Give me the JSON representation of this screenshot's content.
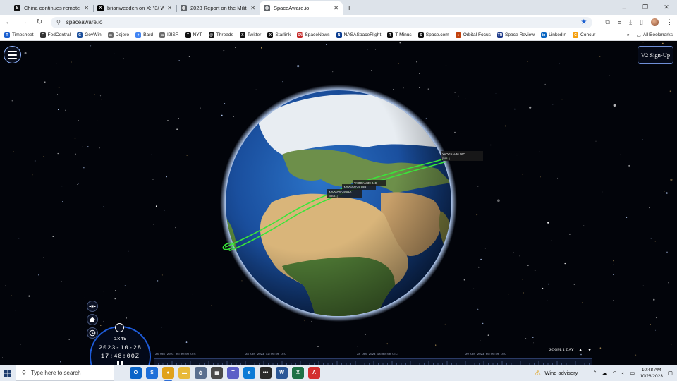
{
  "browser": {
    "tabs": [
      {
        "title": "China continues remote-sensin",
        "favicon": "S",
        "color": "#111111",
        "active": false
      },
      {
        "title": "brianweeden on X: \"3/ While i",
        "favicon": "X",
        "color": "#000000",
        "active": false
      },
      {
        "title": "2023 Report on the Military an",
        "favicon": "globe",
        "color": "#5f6368",
        "active": false
      },
      {
        "title": "SpaceAware.io",
        "favicon": "globe",
        "color": "#5f6368",
        "active": true
      }
    ],
    "new_tab": "+",
    "window_controls": [
      "–",
      "❐",
      "✕"
    ],
    "url": "spaceaware.io"
  },
  "bookmarks": {
    "items": [
      {
        "label": "Timesheet",
        "color": "#1a5fd0",
        "glyph": "T"
      },
      {
        "label": "FedCentral",
        "color": "#333333",
        "glyph": "F"
      },
      {
        "label": "GovWin",
        "color": "#1b4f9c",
        "glyph": "G"
      },
      {
        "label": "Dejero",
        "color": "#6b6b6b",
        "glyph": "▭"
      },
      {
        "label": "Bard",
        "color": "#4285f4",
        "glyph": "✦"
      },
      {
        "label": "I2ISR",
        "color": "#6b6b6b",
        "glyph": "▭"
      },
      {
        "label": "NYT",
        "color": "#111111",
        "glyph": "T"
      },
      {
        "label": "Threads",
        "color": "#111111",
        "glyph": "@"
      },
      {
        "label": "Twitter",
        "color": "#111111",
        "glyph": "X"
      },
      {
        "label": "Starlink",
        "color": "#111111",
        "glyph": "X"
      },
      {
        "label": "SpaceNews",
        "color": "#c62828",
        "glyph": "SN"
      },
      {
        "label": "NASASpaceFlight",
        "color": "#0b3d91",
        "glyph": "N"
      },
      {
        "label": "T-Minus",
        "color": "#111111",
        "glyph": "T"
      },
      {
        "label": "Space.com",
        "color": "#111111",
        "glyph": "S"
      },
      {
        "label": "Orbital Focus",
        "color": "#c2410c",
        "glyph": "●"
      },
      {
        "label": "Space Review",
        "color": "#1e3a8a",
        "glyph": "TR"
      },
      {
        "label": "LinkedIn",
        "color": "#0a66c2",
        "glyph": "in"
      },
      {
        "label": "Concur",
        "color": "#f59e0b",
        "glyph": "C"
      }
    ],
    "more": "»",
    "all_bookmarks": "All Bookmarks"
  },
  "app": {
    "signup_label": "V2 Sign-Up",
    "satellite_labels": [
      {
        "name": "YAOGAN-36 06C",
        "sub": "[583..]"
      },
      {
        "name": "YAOGAN-39 04C",
        "sub": ""
      },
      {
        "name": "YAOGAN-39 05B",
        "sub": ""
      },
      {
        "name": "YAOGAN-39 04A",
        "sub": "[58041]"
      }
    ],
    "clock": {
      "speed": "1x49",
      "date": "2023-10-28",
      "time": "17:48:00Z"
    },
    "timeline": {
      "ticks": [
        "28 Oct 2023 06:00:00 UTC",
        "28 Oct 2023 12:00:00 UTC",
        "28 Oct 2023 18:00:00 UTC",
        "29 Oct 2023 00:00:00 UTC"
      ],
      "zoom_label": "1 DAY",
      "zoom_prefix": "ZOOM:"
    },
    "orbit_color": "#39e639"
  },
  "taskbar": {
    "search_placeholder": "Type here to search",
    "apps": [
      {
        "name": "outlook",
        "color": "#0a64c8",
        "glyph": "O"
      },
      {
        "name": "spaceaware",
        "color": "#1e6fd9",
        "glyph": "S"
      },
      {
        "name": "chrome",
        "color": "#e0a21b",
        "glyph": "●"
      },
      {
        "name": "explorer",
        "color": "#e8b93a",
        "glyph": "▬"
      },
      {
        "name": "settings-app",
        "color": "#5a6f8f",
        "glyph": "⚙"
      },
      {
        "name": "calculator",
        "color": "#4a4a4a",
        "glyph": "▦"
      },
      {
        "name": "teams",
        "color": "#5b5fc7",
        "glyph": "T"
      },
      {
        "name": "edge",
        "color": "#0c7bd6",
        "glyph": "e"
      },
      {
        "name": "chat",
        "color": "#2b2b2b",
        "glyph": "•••"
      },
      {
        "name": "word",
        "color": "#2b5797",
        "glyph": "W"
      },
      {
        "name": "excel",
        "color": "#1e7145",
        "glyph": "X"
      },
      {
        "name": "acrobat",
        "color": "#d32f2f",
        "glyph": "A"
      }
    ],
    "weather": "Wind advisory",
    "time": "10:48 AM",
    "date": "10/28/2023"
  }
}
